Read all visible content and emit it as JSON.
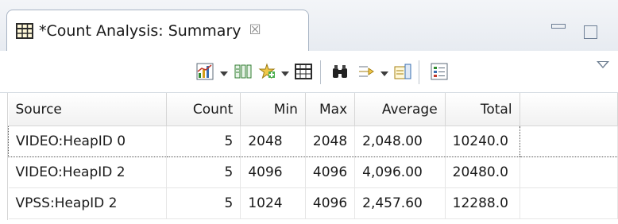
{
  "tab": {
    "title": "*Count Analysis: Summary",
    "close_glyph": "☒",
    "icon": "table-grid-icon"
  },
  "window_controls": {
    "minimize": "minimize-icon",
    "maximize": "maximize-icon"
  },
  "toolbar": {
    "buttons": [
      "chart-icon",
      "column-chooser-icon",
      "add-filter-icon",
      "table-view-icon",
      "find-icon",
      "group-arrow-icon",
      "export-icon",
      "legend-icon"
    ],
    "view_menu": "view-menu-caret-icon"
  },
  "table": {
    "columns": [
      "Source",
      "Count",
      "Min",
      "Max",
      "Average",
      "Total"
    ],
    "rows": [
      [
        "VIDEO:HeapID 0",
        "5",
        "2048",
        "2048",
        "2,048.00",
        "10240.0"
      ],
      [
        "VIDEO:HeapID 2",
        "5",
        "4096",
        "4096",
        "4,096.00",
        "20480.0"
      ],
      [
        "VPSS:HeapID 2",
        "5",
        "1024",
        "4096",
        "2,457.60",
        "12288.0"
      ]
    ],
    "selected_row": 0
  },
  "colors": {
    "tab_border": "#a8b4c4",
    "header_bg": "#f1f1f1",
    "accent_blue": "#3a6fb0"
  }
}
